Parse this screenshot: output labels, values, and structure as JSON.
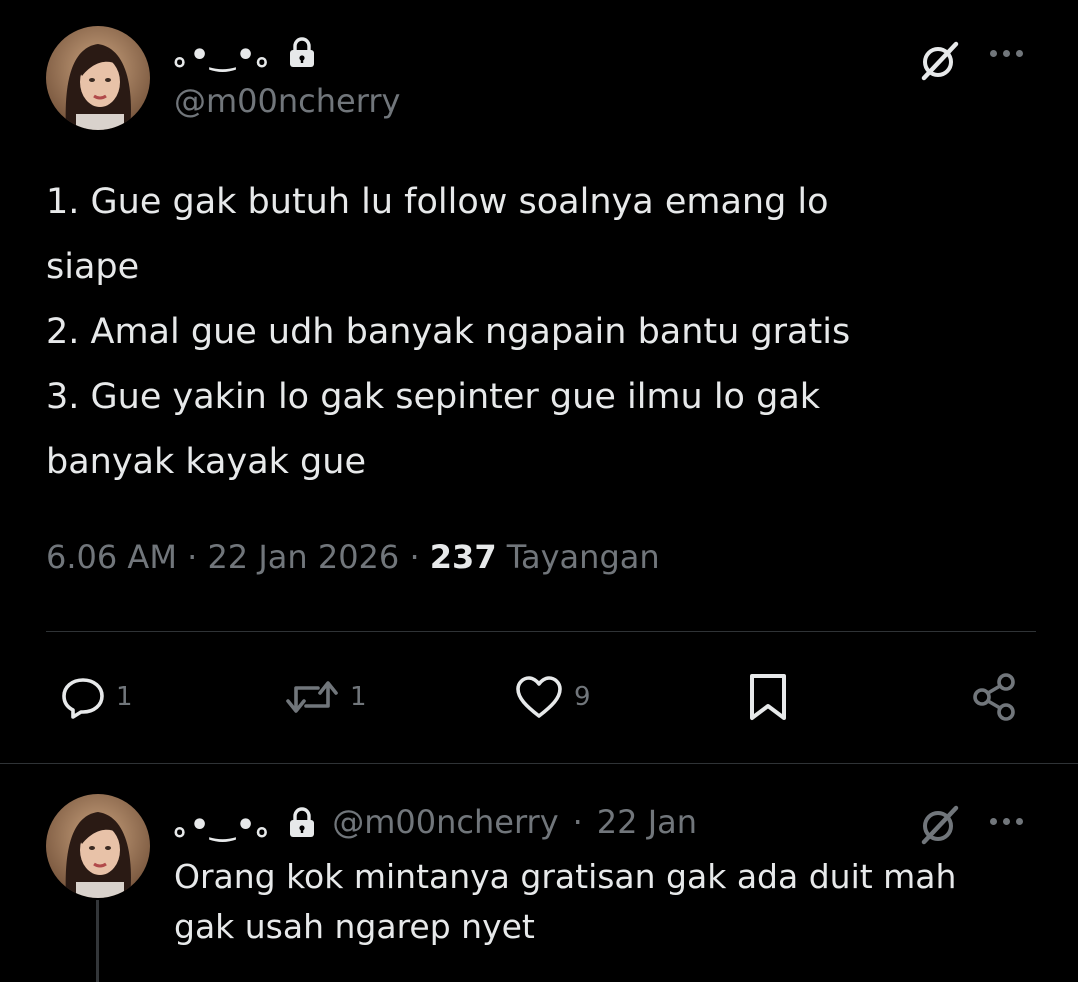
{
  "tweet": {
    "display_name": "｡•‿•｡",
    "handle": "@m00ncherry",
    "text_lines": [
      "1. Gue gak butuh lu follow soalnya emang lo",
      "siape",
      "2. Amal gue udh banyak ngapain bantu gratis",
      "3. Gue yakin lo gak sepinter gue ilmu lo gak",
      "banyak kayak gue"
    ],
    "time": "6.06 AM",
    "date": "22 Jan 2026",
    "views_count": "237",
    "views_label": "Tayangan",
    "separator": "·",
    "actions": {
      "reply_count": "1",
      "retweet_count": "1",
      "like_count": "9"
    }
  },
  "reply": {
    "display_name": "｡•‿•｡",
    "handle": "@m00ncherry",
    "separator": "·",
    "date": "22 Jan",
    "text_lines": [
      "Orang kok mintanya gratisan gak ada duit mah",
      "gak usah ngarep nyet"
    ]
  },
  "icons": {
    "lock": "lock-icon",
    "grok": "grok-icon",
    "more": "more-icon",
    "reply": "reply-icon",
    "retweet": "retweet-icon",
    "like": "heart-icon",
    "bookmark": "bookmark-icon",
    "share": "share-icon"
  },
  "colors": {
    "background": "#000000",
    "text": "#e7e9ea",
    "muted": "#71767b",
    "divider": "#2f3336"
  }
}
